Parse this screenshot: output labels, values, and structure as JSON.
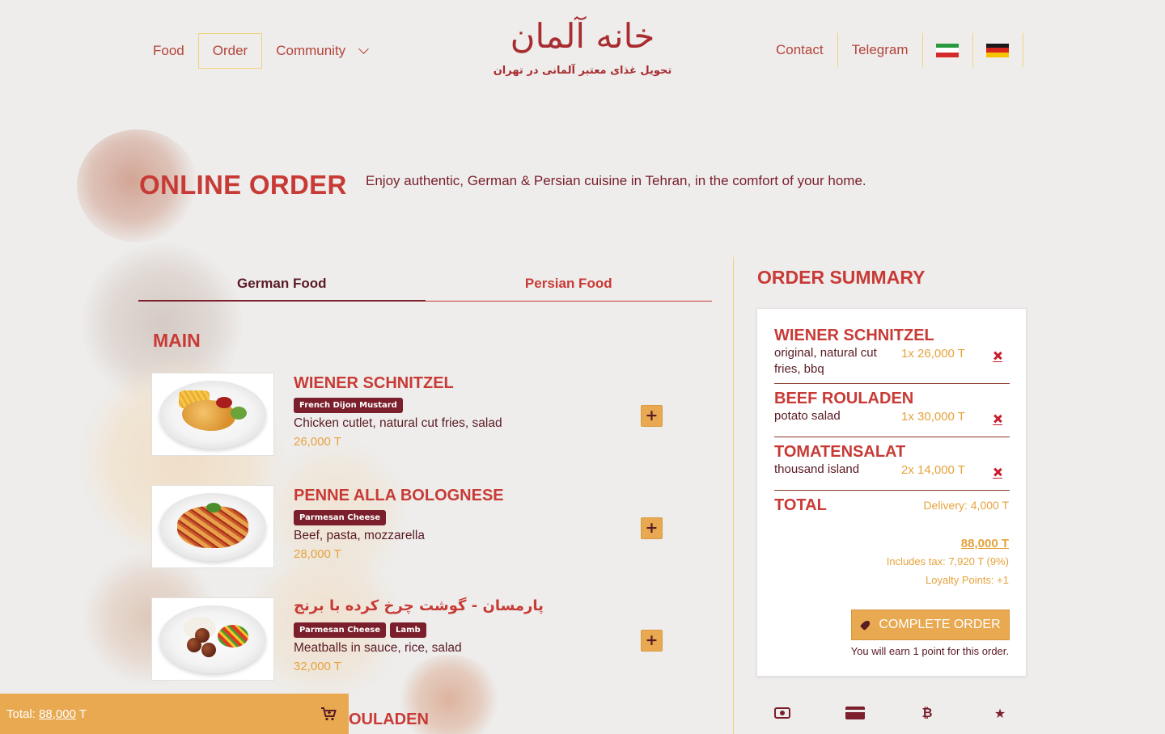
{
  "nav": {
    "left": [
      {
        "label": "Food"
      },
      {
        "label": "Order",
        "active": true
      },
      {
        "label": "Community",
        "dropdown": true
      }
    ],
    "right": [
      {
        "label": "Contact"
      },
      {
        "label": "Telegram"
      }
    ],
    "flags": [
      "iran-flag-icon",
      "germany-flag-icon"
    ]
  },
  "logo": {
    "title": "خانه آلمان",
    "subtitle": "تحویل غذای معتبر آلمانی در تهران"
  },
  "page": {
    "title": "ONLINE ORDER",
    "intro": "Enjoy authentic, German & Persian cuisine in Tehran, in the comfort of your home."
  },
  "tabs": [
    {
      "label": "German Food",
      "active": true
    },
    {
      "label": "Persian Food",
      "active": false
    }
  ],
  "menu": {
    "section_title": "MAIN",
    "items": [
      {
        "name": "WIENER SCHNITZEL",
        "tags": [
          "French Dijon Mustard"
        ],
        "description": "Chicken cutlet, natural cut fries, salad",
        "price": "26,000 T"
      },
      {
        "name": "PENNE ALLA BOLOGNESE",
        "tags": [
          "Parmesan Cheese"
        ],
        "description": "Beef, pasta, mozzarella",
        "price": "28,000 T"
      },
      {
        "name": "پارمسان - گوشت چرخ کرده با برنج",
        "tags": [
          "Parmesan Cheese",
          "Lamb"
        ],
        "description": "Meatballs in sauce, rice, salad",
        "price": "32,000 T"
      }
    ],
    "next_item_partial": "OULADEN"
  },
  "summary": {
    "title": "ORDER SUMMARY",
    "items": [
      {
        "name": "WIENER SCHNITZEL",
        "options": "original, natural cut fries, bbq",
        "qty_price": "1x 26,000 T"
      },
      {
        "name": "BEEF ROULADEN",
        "options": "potato salad",
        "qty_price": "1x 30,000 T"
      },
      {
        "name": "TOMATENSALAT",
        "options": "thousand island",
        "qty_price": "2x 14,000 T"
      }
    ],
    "total_label": "TOTAL",
    "delivery": "Delivery: 4,000 T",
    "grand_total": "88,000 T",
    "tax": "Includes tax: 7,920 T (9%)",
    "loyalty": "Loyalty Points: +1",
    "complete_label": "COMPLETE ORDER",
    "earn_note": "You will earn 1 point for this order."
  },
  "payment_icons": [
    "cash-icon",
    "credit-card-icon",
    "bitcoin-icon",
    "star-icon"
  ],
  "cart_bar": {
    "label": "Total: ",
    "amount": "88,000",
    "currency": " T"
  },
  "colors": {
    "accent_red": "#c83a35",
    "maroon": "#7a1f2b",
    "gold": "#e8a951",
    "price_gold": "#e6a23c",
    "divider_yellow": "#f0d47a"
  }
}
